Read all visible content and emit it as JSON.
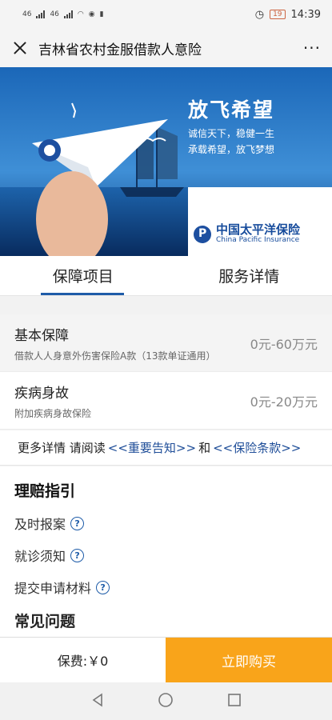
{
  "status_bar": {
    "network_left": "46",
    "network_right": "46",
    "battery": "19",
    "time": "14:39"
  },
  "nav": {
    "title": "吉林省农村金服借款人意险"
  },
  "banner": {
    "headline": "放飞希望",
    "line1": "诚信天下，稳健一生",
    "line2": "承载希望，放飞梦想",
    "brand_cn": "中国太平洋保险",
    "brand_en": "China Pacific Insurance"
  },
  "tabs": [
    {
      "label": "保障项目",
      "active": true
    },
    {
      "label": "服务详情",
      "active": false
    }
  ],
  "coverage": [
    {
      "name": "基本保障",
      "desc": "借款人人身意外伤害保险A款（13款单证通用）",
      "amount": "0元-60万元"
    },
    {
      "name": "疾病身故",
      "desc": "附加疾病身故保险",
      "amount": "0元-20万元"
    }
  ],
  "notice": {
    "prefix": "更多详情 请阅读",
    "link1": "<<重要告知>>",
    "mid": "和",
    "link2": "<<保险条款>>"
  },
  "claims": {
    "title": "理赔指引",
    "items": [
      "及时报案",
      "就诊须知",
      "提交申请材料"
    ]
  },
  "faq": {
    "title": "常见问题"
  },
  "bottom": {
    "premium": "保费:￥0",
    "buy": "立即购买"
  },
  "colors": {
    "brand_blue": "#1f5ca8",
    "buy_orange": "#f9a41a"
  }
}
